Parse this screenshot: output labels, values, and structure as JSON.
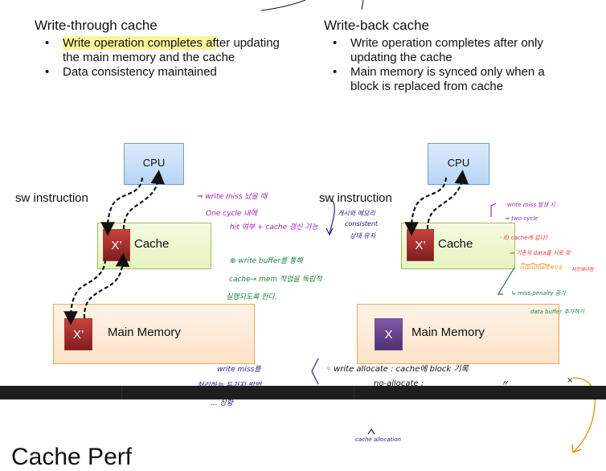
{
  "left_section": {
    "heading": "Write-through cache",
    "bullets": [
      {
        "highlighted": "Write operation completes af",
        "rest": "ter updating the main memory and the cache"
      },
      {
        "text": "Data consistency maintained"
      }
    ]
  },
  "right_section": {
    "heading": "Write-back cache",
    "bullets": [
      {
        "text": "Write operation completes after only updating the cache"
      },
      {
        "text": "Main memory is synced only when a block is replaced from cache"
      }
    ]
  },
  "diagram_left": {
    "cpu_label": "CPU",
    "instruction_label": "sw instruction",
    "cache_label": "Cache",
    "cache_block": "X’",
    "memory_label": "Main Memory",
    "memory_block": "X’"
  },
  "diagram_right": {
    "cpu_label": "CPU",
    "instruction_label": "sw instruction",
    "cache_label": "Cache",
    "cache_block": "X’",
    "memory_label": "Main Memory",
    "memory_block": "X"
  },
  "annotations": {
    "purple_1": "⇒ write miss 났을 때",
    "purple_2": "One cycle 내에",
    "purple_3": "hit 여부 + cache 갱신 가능",
    "navy_1": "캐시와 메모리",
    "navy_2": "consistent",
    "navy_3": "상태 유지",
    "green_1": "⊕ write buffer를 통해",
    "green_2": "cache→ mem 작업을 독립적",
    "green_3": "실행되도록 한다.",
    "right_purple_1": "write miss 발생 시",
    "right_purple_2": "⇒ two-cycle",
    "right_red_1": "· if) cache에 없다?",
    "right_red_2": "⇒ 기존의 data를 서로 맞",
    "right_orange_1": "inconsistent하므로",
    "right_red_3": "저장해야함",
    "right_green_1": "↳ miss penalty 증가",
    "right_green_2": "data buffer 추가하기",
    "bottom_navy_1": "write miss를",
    "bottom_navy_2": "처리하는 두가지 방법",
    "bottom_navy_3": "... 상황",
    "bottom_black_1": "◦ write   allocate :   cache에  block 기록",
    "bottom_black_2": "no-allocate :",
    "bottom_black_3": "〃",
    "bottom_black_4": "×",
    "bottom_navy_4": "cache allocation"
  },
  "bottom_title": "Cache Perf"
}
